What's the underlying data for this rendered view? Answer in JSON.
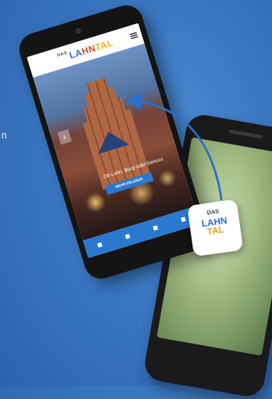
{
  "background_color": "#3a77c2",
  "edge_letter": "n",
  "front_phone": {
    "app": {
      "logo": {
        "prefix": "DAS",
        "part1": "LA",
        "part2": "HN",
        "part3": "TAL"
      },
      "menu_icon": "hamburger-icon",
      "hero_caption": "Ob Lahn, Burg oder Genuss",
      "cta_label": "MEHR ERLEBEN",
      "prev_icon": "chevron-left-icon",
      "prev_glyph": "‹"
    }
  },
  "app_icon": {
    "line1": "DAS",
    "line2": "LAHN",
    "line3": "TAL"
  },
  "accent_color": "#2a78d0"
}
